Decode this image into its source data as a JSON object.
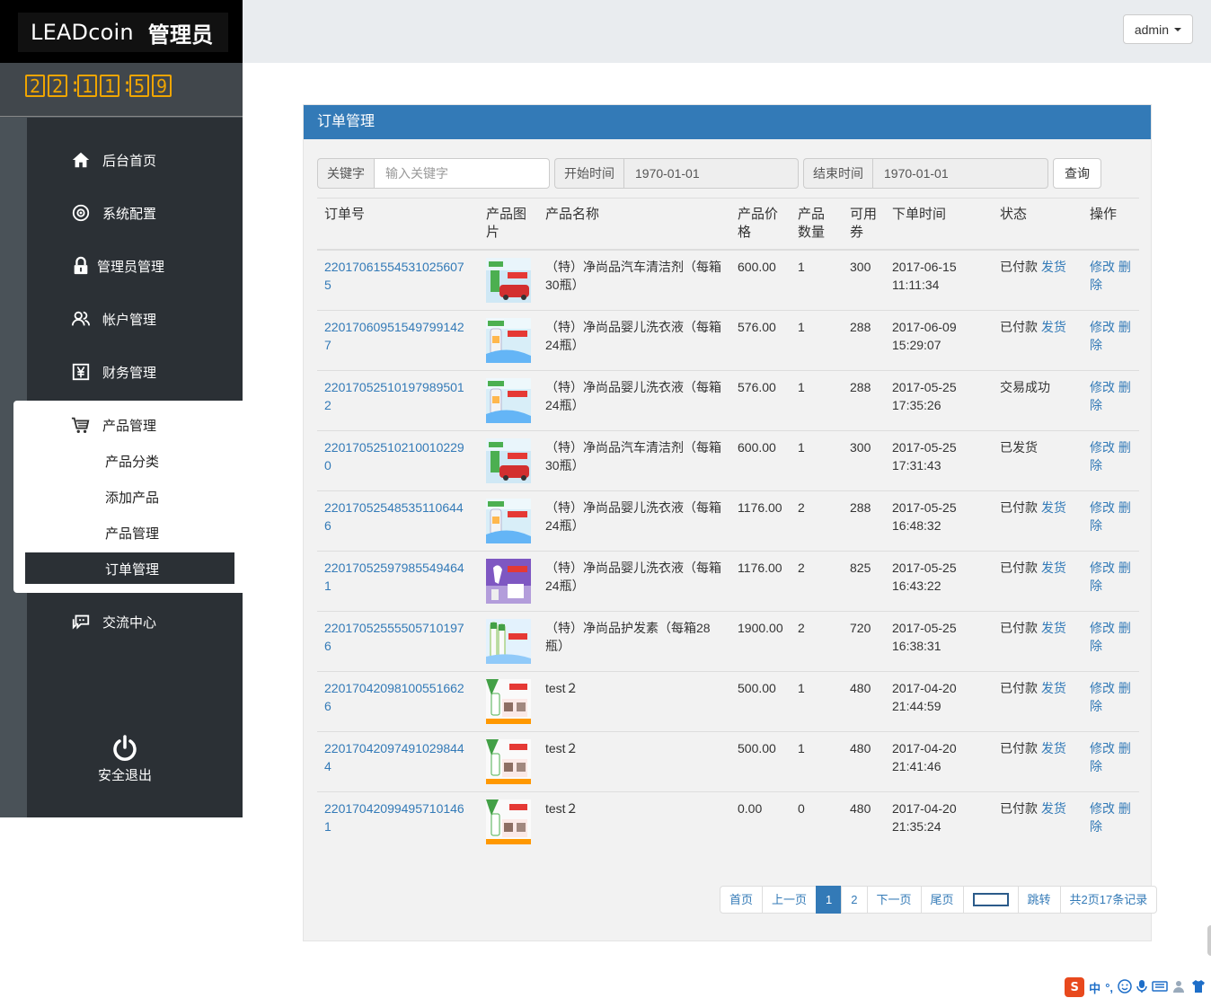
{
  "brand": {
    "logo": "LEADcoin",
    "role": "管理员"
  },
  "clock": {
    "h1": "2",
    "h2": "2",
    "m1": "1",
    "m2": "1",
    "s1": "5",
    "s2": "9"
  },
  "user_menu": {
    "label": "admin"
  },
  "sidebar": {
    "items": [
      {
        "label": "后台首页",
        "icon": "home-icon"
      },
      {
        "label": "系统配置",
        "icon": "settings-icon"
      },
      {
        "label": "管理员管理",
        "icon": "lock-icon"
      },
      {
        "label": "帐户管理",
        "icon": "users-icon"
      },
      {
        "label": "财务管理",
        "icon": "yen-icon"
      },
      {
        "label": "产品管理",
        "icon": "cart-icon"
      },
      {
        "label": "交流中心",
        "icon": "chat-icon"
      }
    ],
    "sub_items": [
      "产品分类",
      "添加产品",
      "产品管理",
      "订单管理"
    ],
    "logout": "安全退出"
  },
  "panel": {
    "title": "订单管理"
  },
  "search": {
    "keyword_label": "关键字",
    "keyword_placeholder": "输入关键字",
    "start_label": "开始时间",
    "start_value": "1970-01-01",
    "end_label": "结束时间",
    "end_value": "1970-01-01",
    "query_button": "查询"
  },
  "table": {
    "headers": [
      "订单号",
      "产品图片",
      "产品名称",
      "产品价格",
      "产品数量",
      "可用券",
      "下单时间",
      "状态",
      "操作"
    ],
    "action_edit": "修改",
    "action_delete": "删除",
    "ship_link": "发货",
    "rows": [
      {
        "order_no": "22017061554531025607 5",
        "thumb": "car",
        "name": "（特）净尚品汽车清洁剂（每箱30瓶）",
        "price": "600.00",
        "qty": "1",
        "coupon": "300",
        "date": "2017-06-15",
        "time": "11:11:34",
        "status": "已付款",
        "ship": true
      },
      {
        "order_no": "22017060951549799142 7",
        "thumb": "baby",
        "name": "（特）净尚品婴儿洗衣液（每箱24瓶）",
        "price": "576.00",
        "qty": "1",
        "coupon": "288",
        "date": "2017-06-09",
        "time": "15:29:07",
        "status": "已付款",
        "ship": true
      },
      {
        "order_no": "22017052510197989501 2",
        "thumb": "baby",
        "name": "（特）净尚品婴儿洗衣液（每箱24瓶）",
        "price": "576.00",
        "qty": "1",
        "coupon": "288",
        "date": "2017-05-25",
        "time": "17:35:26",
        "status": "交易成功",
        "ship": false
      },
      {
        "order_no": "22017052510210010229 0",
        "thumb": "car",
        "name": "（特）净尚品汽车清洁剂（每箱30瓶）",
        "price": "600.00",
        "qty": "1",
        "coupon": "300",
        "date": "2017-05-25",
        "time": "17:31:43",
        "status": "已发货",
        "ship": false
      },
      {
        "order_no": "22017052548535110644 6",
        "thumb": "baby",
        "name": "（特）净尚品婴儿洗衣液（每箱24瓶）",
        "price": "1176.00",
        "qty": "2",
        "coupon": "288",
        "date": "2017-05-25",
        "time": "16:48:32",
        "status": "已付款",
        "ship": true
      },
      {
        "order_no": "22017052597985549464 1",
        "thumb": "purple",
        "name": "（特）净尚品婴儿洗衣液（每箱24瓶）",
        "price": "1176.00",
        "qty": "2",
        "coupon": "825",
        "date": "2017-05-25",
        "time": "16:43:22",
        "status": "已付款",
        "ship": true
      },
      {
        "order_no": "22017052555505710197 6",
        "thumb": "hair",
        "name": "（特）净尚品护发素（每箱28瓶）",
        "price": "1900.00",
        "qty": "2",
        "coupon": "720",
        "date": "2017-05-25",
        "time": "16:38:31",
        "status": "已付款",
        "ship": true
      },
      {
        "order_no": "22017042098100551662 6",
        "thumb": "test",
        "name": "test２",
        "price": "500.00",
        "qty": "1",
        "coupon": "480",
        "date": "2017-04-20",
        "time": "21:44:59",
        "status": "已付款",
        "ship": true
      },
      {
        "order_no": "22017042097491029844 4",
        "thumb": "test",
        "name": "test２",
        "price": "500.00",
        "qty": "1",
        "coupon": "480",
        "date": "2017-04-20",
        "time": "21:41:46",
        "status": "已付款",
        "ship": true
      },
      {
        "order_no": "22017042099495710146 1",
        "thumb": "test",
        "name": "test２",
        "price": "0.00",
        "qty": "0",
        "coupon": "480",
        "date": "2017-04-20",
        "time": "21:35:24",
        "status": "已付款",
        "ship": true
      }
    ]
  },
  "pagination": {
    "first": "首页",
    "prev": "上一页",
    "pages": [
      "1",
      "2"
    ],
    "current": "1",
    "next": "下一页",
    "last": "尾页",
    "jump": "跳转",
    "summary": "共2页17条记录"
  },
  "ime_tray": {
    "logo": "S",
    "lang": "中",
    "punct": "°,"
  },
  "colors": {
    "primary": "#337ab7",
    "sidebar_dark": "#2b3035",
    "clock": "#f0a500"
  }
}
